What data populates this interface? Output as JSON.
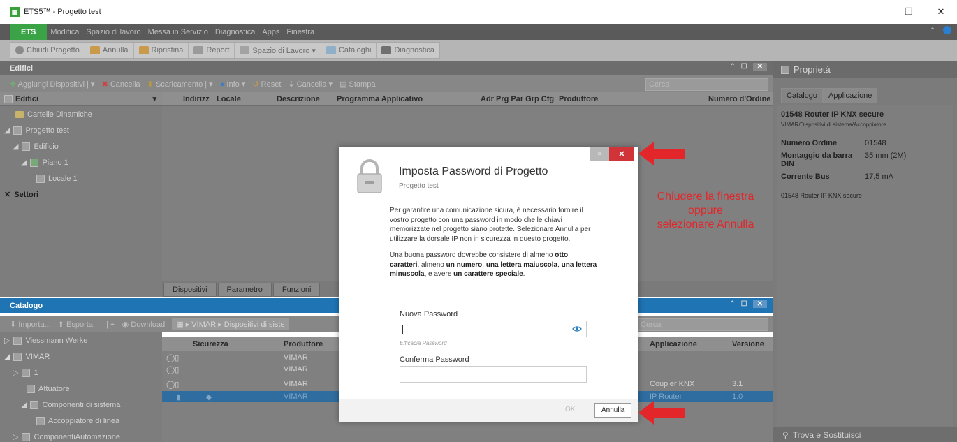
{
  "window": {
    "title": "ETS5™ - Progetto test",
    "logo": "ETS"
  },
  "menubar": {
    "ets": "ETS",
    "items": [
      "Modifica",
      "Spazio di lavoro",
      "Messa in Servizio",
      "Diagnostica",
      "Apps",
      "Finestra"
    ]
  },
  "toolbar": {
    "items": [
      {
        "label": "Chiudi Progetto",
        "icon": "close-project-icon"
      },
      {
        "label": "Annulla",
        "icon": "undo-icon"
      },
      {
        "label": "Ripristina",
        "icon": "redo-icon"
      },
      {
        "label": "Report",
        "icon": "report-icon"
      },
      {
        "label": "Spazio di Lavoro ▾",
        "icon": "workspace-icon"
      },
      {
        "label": "Cataloghi",
        "icon": "catalog-icon"
      },
      {
        "label": "Diagnostica",
        "icon": "diagnostics-icon"
      }
    ]
  },
  "edifici": {
    "title": "Edifici",
    "subtoolbar": [
      "Aggiungi Dispositivi",
      "Cancella",
      "Scaricamento",
      "Info ▾",
      "Reset",
      "Cancella ▾",
      "Stampa"
    ],
    "search_placeholder": "Cerca",
    "tree_header": "Edifici",
    "tree": [
      {
        "label": "Cartelle Dinamiche",
        "indent": 1
      },
      {
        "label": "Progetto test",
        "indent": 0
      },
      {
        "label": "Edificio",
        "indent": 1
      },
      {
        "label": "Piano 1",
        "indent": 2
      },
      {
        "label": "Locale 1",
        "indent": 3
      }
    ],
    "settori": "Settori",
    "columns": [
      "Indirizz",
      "Locale",
      "Descrizione",
      "Programma Applicativo",
      "Adr Prg Par Grp Cfg",
      "Produttore",
      "Numero d'Ordine"
    ],
    "tabs": [
      "Dispositivi",
      "Parametro",
      "Funzioni"
    ]
  },
  "catalogo": {
    "title": "Catalogo",
    "subtoolbar": [
      "Importa...",
      "Esporta...",
      "Download"
    ],
    "breadcrumb": [
      "VIMAR",
      "Dispositivi di siste"
    ],
    "search_placeholder": "Cerca",
    "tree": [
      {
        "label": "Viessmann Werke"
      },
      {
        "label": "VIMAR"
      },
      {
        "label": "1"
      },
      {
        "label": "Attuatore"
      },
      {
        "label": "Componenti di sistema"
      },
      {
        "label": "Accoppiatore di linea"
      },
      {
        "label": "ComponentiAutomazione"
      }
    ],
    "columns": [
      "Sicurezza",
      "Produttore",
      "Applicazione",
      "Versione"
    ],
    "rows": [
      {
        "produttore": "VIMAR",
        "applicazione": "",
        "versione": ""
      },
      {
        "produttore": "VIMAR",
        "applicazione": "",
        "versione": ""
      },
      {
        "produttore": "VIMAR",
        "applicazione": "Coupler KNX",
        "versione": "3.1"
      },
      {
        "produttore": "VIMAR",
        "applicazione": "IP Router",
        "versione": "1.0"
      }
    ]
  },
  "properties": {
    "title": "Proprietà",
    "tabs": [
      "Catalogo",
      "Applicazione"
    ],
    "device_name": "01548 Router IP KNX secure",
    "device_path": "VIMAR/Dispositivi di sistema/Accoppiatore",
    "fields": [
      {
        "key": "Numero Ordine",
        "value": "01548"
      },
      {
        "key": "Montaggio da barra DIN",
        "value": "35 mm (2M)"
      },
      {
        "key": "Corrente Bus",
        "value": "17,5 mA"
      }
    ],
    "description": "01548 Router IP KNX secure",
    "trova": "Trova e Sostituisci"
  },
  "dialog": {
    "title": "Imposta Password di Progetto",
    "subtitle": "Progetto test",
    "para1": "Per garantire una comunicazione sicura, è necessario fornire il vostro progetto con una password in modo che le chiavi memorizzate nel progetto siano protette. Selezionare Annulla per utilizzare la dorsale IP non in sicurezza in questo progetto.",
    "para2_parts": [
      "Una buona password dovrebbe consistere di almeno ",
      "otto caratteri",
      ", almeno ",
      "un numero",
      ", ",
      "una lettera maiuscola",
      ", ",
      "una lettera minuscola",
      ", e avere ",
      "un carattere speciale",
      "."
    ],
    "new_password_label": "Nuova Password",
    "new_password_value": "",
    "strength_label": "Efficacia Password",
    "confirm_password_label": "Conferma Password",
    "confirm_password_value": "",
    "ok": "OK",
    "cancel": "Annulla"
  },
  "annotation": {
    "lines": [
      "Chiudere la finestra",
      "oppure",
      "selezionare Annulla"
    ],
    "color": "#e3262a"
  }
}
